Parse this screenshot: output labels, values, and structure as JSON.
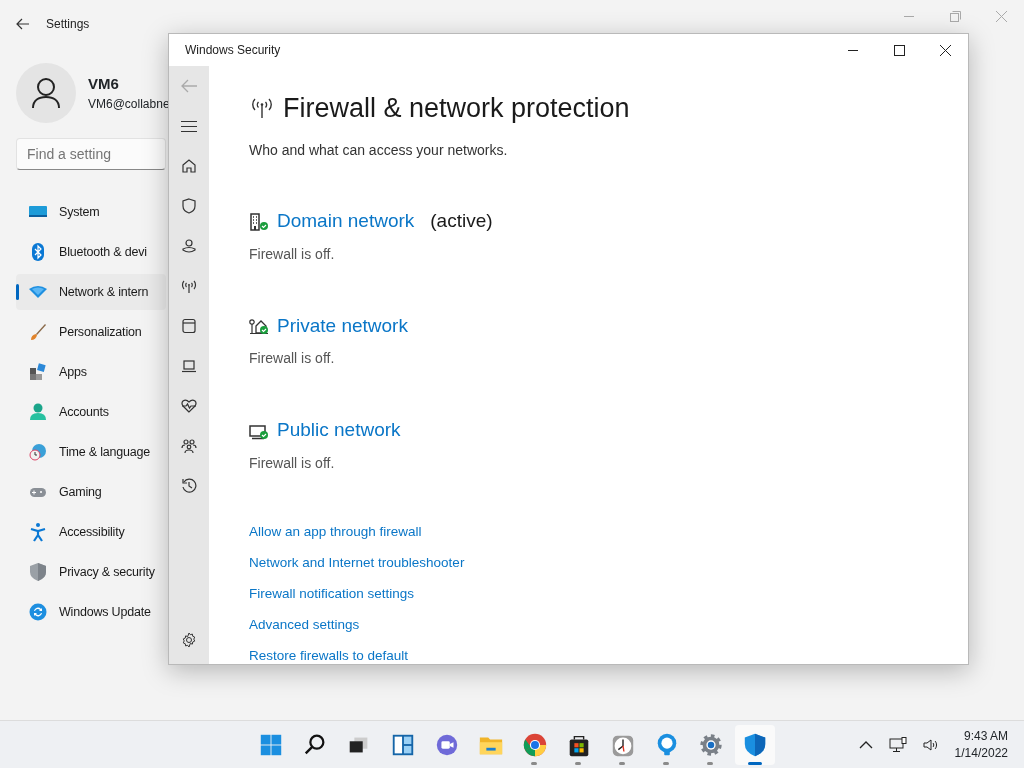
{
  "settings": {
    "title": "Settings",
    "user": {
      "name": "VM6",
      "email": "VM6@collabne"
    },
    "search": {
      "placeholder": "Find a setting"
    },
    "nav": [
      {
        "label": "System",
        "selected": false
      },
      {
        "label": "Bluetooth & devi",
        "selected": false
      },
      {
        "label": "Network & intern",
        "selected": true
      },
      {
        "label": "Personalization",
        "selected": false
      },
      {
        "label": "Apps",
        "selected": false
      },
      {
        "label": "Accounts",
        "selected": false
      },
      {
        "label": "Time & language",
        "selected": false
      },
      {
        "label": "Gaming",
        "selected": false
      },
      {
        "label": "Accessibility",
        "selected": false
      },
      {
        "label": "Privacy & security",
        "selected": false
      },
      {
        "label": "Windows Update",
        "selected": false
      }
    ]
  },
  "security": {
    "title": "Windows Security",
    "heading": "Firewall & network protection",
    "subtitle": "Who and what can access your networks.",
    "networks": [
      {
        "name": "Domain network",
        "tag": "(active)",
        "status": "Firewall is off."
      },
      {
        "name": "Private network",
        "status": "Firewall is off."
      },
      {
        "name": "Public network",
        "status": "Firewall is off."
      }
    ],
    "links": [
      "Allow an app through firewall",
      "Network and Internet troubleshooter",
      "Firewall notification settings",
      "Advanced settings",
      "Restore firewalls to default"
    ]
  },
  "taskbar": {
    "apps": [
      {
        "running": false,
        "selected": false
      },
      {
        "running": false,
        "selected": false
      },
      {
        "running": false,
        "selected": false
      },
      {
        "running": false,
        "selected": false
      },
      {
        "running": false,
        "selected": false
      },
      {
        "running": false,
        "selected": false
      },
      {
        "running": true,
        "selected": false
      },
      {
        "running": true,
        "selected": false
      },
      {
        "running": true,
        "selected": false
      },
      {
        "running": true,
        "selected": false
      },
      {
        "running": true,
        "selected": false
      },
      {
        "running": true,
        "selected": true
      }
    ],
    "time": "9:43 AM",
    "date": "1/14/2022"
  }
}
